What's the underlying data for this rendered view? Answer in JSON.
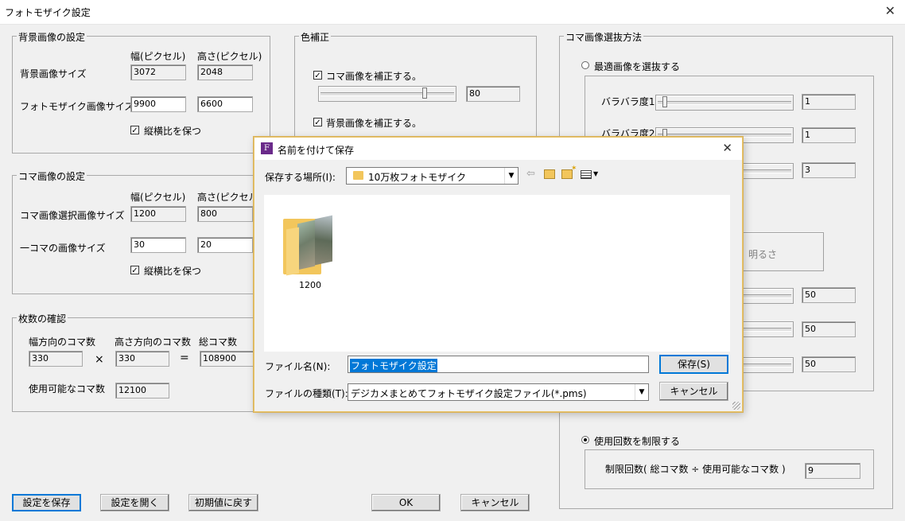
{
  "window": {
    "title": "フォトモザイク設定",
    "close_glyph": "✕"
  },
  "bg_group": {
    "title": "背景画像の設定",
    "col_width": "幅(ピクセル)",
    "col_height": "高さ(ピクセル)",
    "row1_label": "背景画像サイズ",
    "row1_w": "3072",
    "row1_h": "2048",
    "row2_label": "フォトモザイク画像サイズ",
    "row2_w": "9900",
    "row2_h": "6600",
    "keep_ratio_label": "縦横比を保つ",
    "keep_ratio_checked": true
  },
  "koma_group": {
    "title": "コマ画像の設定",
    "col_width": "幅(ピクセル)",
    "col_height": "高さ(ピクセル",
    "row1_label": "コマ画像選択画像サイズ",
    "row1_w": "1200",
    "row1_h": "800",
    "row2_label": "一コマの画像サイズ",
    "row2_w": "30",
    "row2_h": "20",
    "keep_ratio_label": "縦横比を保つ",
    "keep_ratio_checked": true
  },
  "count_group": {
    "title": "枚数の確認",
    "h_label": "幅方向のコマ数",
    "v_label": "高さ方向のコマ数",
    "total_label": "総コマ数",
    "h_value": "330",
    "v_value": "330",
    "total_value": "108900",
    "times": "×",
    "equals": "=",
    "usable_label": "使用可能なコマ数",
    "usable_value": "12100"
  },
  "color_group": {
    "title": "色補正",
    "koma_label": "コマ画像を補正する。",
    "koma_value": "80",
    "bg_label": "背景画像を補正する。"
  },
  "select_group": {
    "title": "コマ画像選抜方法",
    "optimal_label": "最適画像を選抜する",
    "bara1_label": "バラバラ度1",
    "bara1_value": "1",
    "bara2_label": "バラバラ度2",
    "bara2_value": "1",
    "third_value": "3",
    "brightness_text": "、明るさ",
    "v1": "50",
    "v2": "50",
    "v3": "50",
    "limit_label": "使用回数を制限する",
    "limit_text": "制限回数( 総コマ数 ÷ 使用可能なコマ数 )",
    "limit_value": "9"
  },
  "buttons": {
    "save_settings": "設定を保存",
    "open_settings": "設定を開く",
    "reset": "初期値に戻す",
    "ok": "OK",
    "cancel": "キャンセル"
  },
  "save_dialog": {
    "title": "名前を付けて保存",
    "location_label": "保存する場所(I):",
    "location_value": "10万枚フォトモザイク",
    "folder_name": "1200",
    "filename_label": "ファイル名(N):",
    "filename_value": "フォトモザイク設定",
    "filetype_label": "ファイルの種類(T):",
    "filetype_value": "デジカメまとめてフォトモザイク設定ファイル(*.pms)",
    "save_button": "保存(S)",
    "cancel_button": "キャンセル",
    "close_glyph": "✕",
    "icon_letter": "F"
  },
  "colors": {
    "accent": "#0078d7",
    "dialog_border": "#e8c46b",
    "folder": "#f2c65c"
  }
}
